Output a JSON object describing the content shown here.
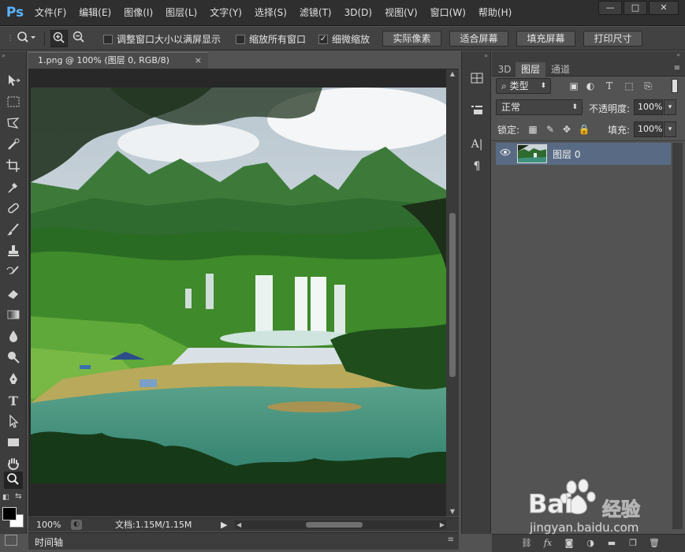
{
  "app": {
    "logo": "Ps",
    "menu": [
      "文件(F)",
      "编辑(E)",
      "图像(I)",
      "图层(L)",
      "文字(Y)",
      "选择(S)",
      "滤镜(T)",
      "3D(D)",
      "视图(V)",
      "窗口(W)",
      "帮助(H)"
    ],
    "window_controls": {
      "minimize": "—",
      "maximize": "□",
      "close": "✕"
    }
  },
  "options_bar": {
    "tool_icon": "zoom-icon",
    "zoom_in_icon": "zoom-in-icon",
    "zoom_out_icon": "zoom-out-icon",
    "checkboxes": [
      {
        "label": "调整窗口大小以满屏显示",
        "checked": false
      },
      {
        "label": "缩放所有窗口",
        "checked": false
      },
      {
        "label": "细微缩放",
        "checked": true
      }
    ],
    "buttons": [
      "实际像素",
      "适合屏幕",
      "填充屏幕",
      "打印尺寸"
    ],
    "check_mark": "✓"
  },
  "document": {
    "tab_title": "1.png @ 100% (图层 0, RGB/8)",
    "tab_close": "×",
    "zoom": "100%",
    "doc_info": "文档:1.15M/1.15M",
    "timeline_label": "时间轴"
  },
  "layers_panel": {
    "tabs": [
      "3D",
      "图层",
      "通道"
    ],
    "active_tab": "图层",
    "filter_kind": "类型",
    "blend_mode": "正常",
    "opacity_label": "不透明度:",
    "opacity_value": "100%",
    "lock_label": "锁定:",
    "fill_label": "填充:",
    "fill_value": "100%",
    "layers": [
      {
        "name": "图层 0",
        "visible": true,
        "selected": true
      }
    ]
  },
  "colors": {
    "foreground": "#000000",
    "background": "#ffffff",
    "selection": "#596b84",
    "ps_blue": "#5ab4ff"
  },
  "watermark": {
    "brand": "Bai",
    "brand_suffix": "经验",
    "url": "jingyan.baidu.com"
  }
}
